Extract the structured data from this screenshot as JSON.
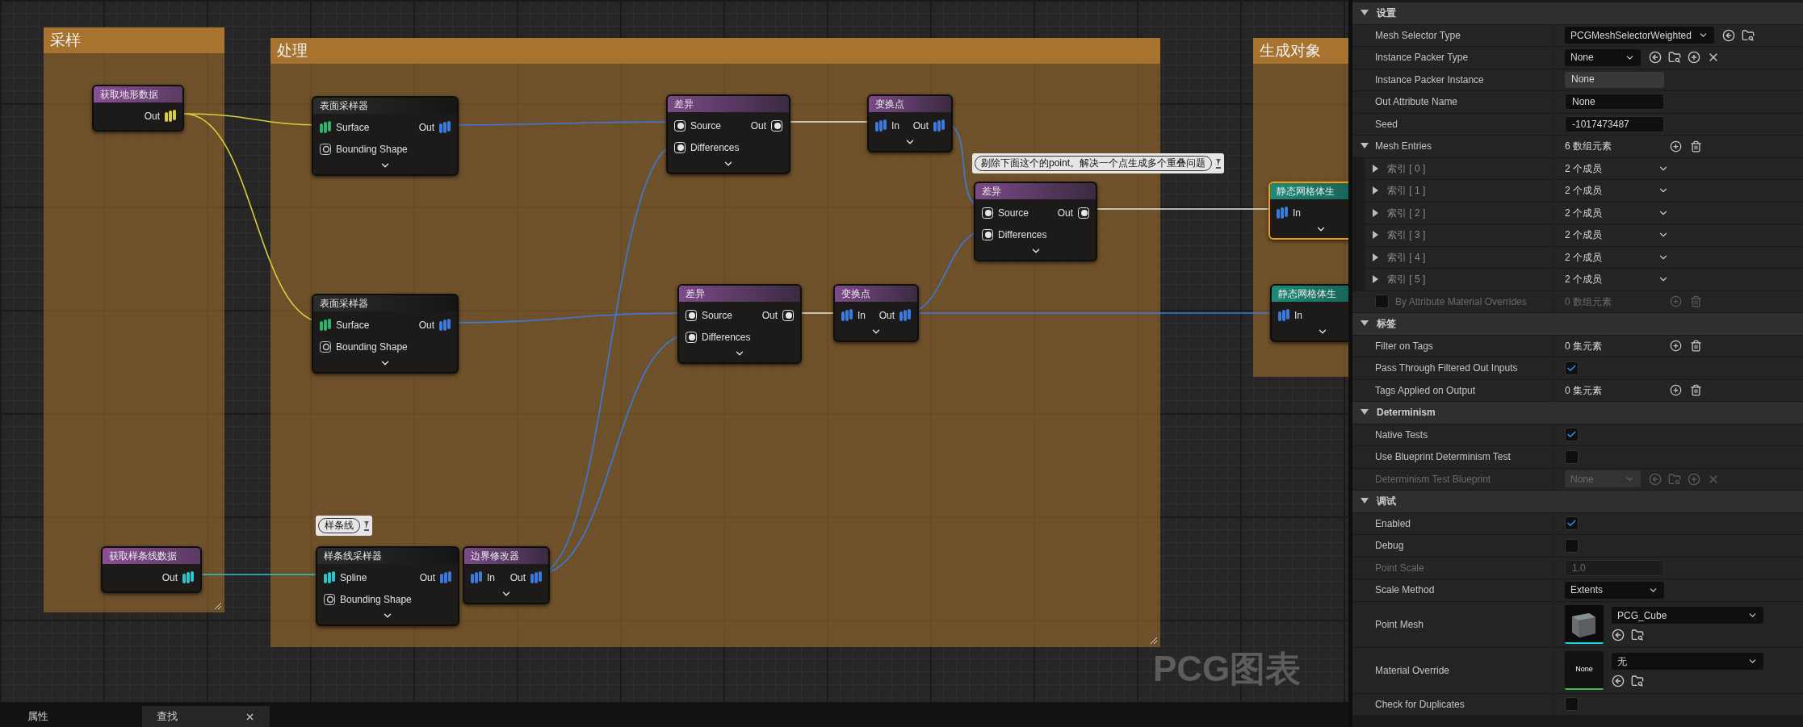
{
  "graph": {
    "comments": [
      {
        "title": "采样"
      },
      {
        "title": "处理"
      },
      {
        "title": "生成对象"
      }
    ],
    "nodes": [
      {
        "title": "获取地形数据",
        "kind": "input",
        "selected": false,
        "expandable": false,
        "outputs": [
          {
            "label": "Out",
            "kind": "bars",
            "color": "#d8cf3c"
          }
        ]
      },
      {
        "title": "表面采样器",
        "kind": "sampler",
        "selected": false,
        "expandable": true,
        "inputs": [
          {
            "label": "Surface",
            "kind": "bars",
            "color": "#35b06a"
          },
          {
            "label": "Bounding Shape",
            "kind": "ring",
            "color": "#c8c8c8"
          }
        ],
        "outputs": [
          {
            "label": "Out",
            "kind": "bars",
            "color": "#3a7be0"
          }
        ]
      },
      {
        "title": "差异",
        "kind": "filter",
        "selected": false,
        "expandable": true,
        "inputs": [
          {
            "label": "Source",
            "kind": "circle",
            "color": "#e6e6e6"
          },
          {
            "label": "Differences",
            "kind": "circle",
            "color": "#e6e6e6"
          }
        ],
        "outputs": [
          {
            "label": "Out",
            "kind": "circle",
            "color": "#e6e6e6"
          }
        ]
      },
      {
        "title": "变换点",
        "kind": "filter",
        "selected": false,
        "expandable": true,
        "inputs": [
          {
            "label": "In",
            "kind": "bars",
            "color": "#3a7be0"
          }
        ],
        "outputs": [
          {
            "label": "Out",
            "kind": "bars",
            "color": "#3a7be0"
          }
        ]
      },
      {
        "title": "差异",
        "kind": "filter",
        "selected": false,
        "expandable": true,
        "inputs": [
          {
            "label": "Source",
            "kind": "circle",
            "color": "#e6e6e6"
          },
          {
            "label": "Differences",
            "kind": "circle",
            "color": "#e6e6e6"
          }
        ],
        "outputs": [
          {
            "label": "Out",
            "kind": "circle",
            "color": "#e6e6e6"
          }
        ]
      },
      {
        "title": "静态网格体生",
        "kind": "spawner",
        "selected": true,
        "expandable": true,
        "inputs": [
          {
            "label": "In",
            "kind": "bars",
            "color": "#3a7be0"
          }
        ]
      },
      {
        "title": "表面采样器",
        "kind": "sampler",
        "selected": false,
        "expandable": true,
        "inputs": [
          {
            "label": "Surface",
            "kind": "bars",
            "color": "#35b06a"
          },
          {
            "label": "Bounding Shape",
            "kind": "ring",
            "color": "#c8c8c8"
          }
        ],
        "outputs": [
          {
            "label": "Out",
            "kind": "bars",
            "color": "#3a7be0"
          }
        ]
      },
      {
        "title": "差异",
        "kind": "filter",
        "selected": false,
        "expandable": true,
        "inputs": [
          {
            "label": "Source",
            "kind": "circle",
            "color": "#e6e6e6"
          },
          {
            "label": "Differences",
            "kind": "circle",
            "color": "#e6e6e6"
          }
        ],
        "outputs": [
          {
            "label": "Out",
            "kind": "circle",
            "color": "#e6e6e6"
          }
        ]
      },
      {
        "title": "变换点",
        "kind": "filter",
        "selected": false,
        "expandable": true,
        "inputs": [
          {
            "label": "In",
            "kind": "bars",
            "color": "#3a7be0"
          }
        ],
        "outputs": [
          {
            "label": "Out",
            "kind": "bars",
            "color": "#3a7be0"
          }
        ]
      },
      {
        "title": "静态网格体生",
        "kind": "spawner",
        "selected": false,
        "expandable": true,
        "inputs": [
          {
            "label": "In",
            "kind": "bars",
            "color": "#3a7be0"
          }
        ]
      },
      {
        "title": "获取样条线数据",
        "kind": "input",
        "selected": false,
        "expandable": false,
        "outputs": [
          {
            "label": "Out",
            "kind": "bars",
            "color": "#2ec4c9"
          }
        ]
      },
      {
        "title": "样条线采样器",
        "kind": "sampler",
        "selected": false,
        "expandable": true,
        "inputs": [
          {
            "label": "Spline",
            "kind": "bars",
            "color": "#2ec4c9"
          },
          {
            "label": "Bounding Shape",
            "kind": "ring",
            "color": "#c8c8c8"
          }
        ],
        "outputs": [
          {
            "label": "Out",
            "kind": "bars",
            "color": "#3a7be0"
          }
        ]
      },
      {
        "title": "边界修改器",
        "kind": "filter",
        "selected": false,
        "expandable": true,
        "inputs": [
          {
            "label": "In",
            "kind": "bars",
            "color": "#3a7be0"
          }
        ],
        "outputs": [
          {
            "label": "Out",
            "kind": "bars",
            "color": "#3a7be0"
          }
        ]
      }
    ],
    "bubbles": [
      {
        "text": "剔除下面这个的point。解决一个点生成多个重叠问题",
        "pinned": true
      },
      {
        "text": "样条线",
        "pinned": true
      }
    ],
    "watermark": "PCG图表"
  },
  "bottom_tabs": [
    {
      "label": "属性",
      "selected": false,
      "closable": false
    },
    {
      "label": "查找",
      "selected": true,
      "closable": true
    }
  ],
  "details": {
    "sections": [
      {
        "title": "设置",
        "expanded": true,
        "rows": [
          {
            "kind": "combo",
            "label": "Mesh Selector Type",
            "value": "PCGMeshSelectorWeighted",
            "clearable": false,
            "disabled": false
          },
          {
            "kind": "combo",
            "label": "Instance Packer Type",
            "value": "None",
            "clearable": true,
            "disabled": false
          },
          {
            "kind": "readonly",
            "label": "Instance Packer Instance",
            "value": "None",
            "disabled": false
          },
          {
            "kind": "text",
            "label": "Out Attribute Name",
            "value": "None",
            "disabled": false
          },
          {
            "kind": "text",
            "label": "Seed",
            "value": "-1017473487",
            "disabled": false
          },
          {
            "kind": "array",
            "label": "Mesh Entries",
            "value": "6 数组元素",
            "expanded": true,
            "disabled": false,
            "children": [
              {
                "label": "索引 [ 0 ]",
                "value": "2 个成员",
                "expanded": false
              },
              {
                "label": "索引 [ 1 ]",
                "value": "2 个成员",
                "expanded": false
              },
              {
                "label": "索引 [ 2 ]",
                "value": "2 个成员",
                "expanded": false
              },
              {
                "label": "索引 [ 3 ]",
                "value": "2 个成员",
                "expanded": false
              },
              {
                "label": "索引 [ 4 ]",
                "value": "2 个成员",
                "expanded": false
              },
              {
                "label": "索引 [ 5 ]",
                "value": "2 个成员",
                "expanded": false
              }
            ]
          },
          {
            "kind": "array",
            "label": "By Attribute Material Overrides",
            "value": "0 数组元素",
            "checked": false,
            "disabled": true
          }
        ]
      },
      {
        "title": "标签",
        "expanded": true,
        "rows": [
          {
            "kind": "array",
            "label": "Filter on Tags",
            "value": "0 集元素",
            "disabled": false
          },
          {
            "kind": "checkbox",
            "label": "Pass Through Filtered Out Inputs",
            "checked": true,
            "disabled": false
          },
          {
            "kind": "array",
            "label": "Tags Applied on Output",
            "value": "0 集元素",
            "disabled": false
          }
        ]
      },
      {
        "title": "Determinism",
        "expanded": true,
        "rows": [
          {
            "kind": "checkbox",
            "label": "Native Tests",
            "checked": true,
            "disabled": false
          },
          {
            "kind": "checkbox",
            "label": "Use Blueprint Determinism Test",
            "checked": false,
            "disabled": false
          },
          {
            "kind": "combo",
            "label": "Determinism Test Blueprint",
            "value": "None",
            "clearable": true,
            "disabled": true
          }
        ]
      },
      {
        "title": "调试",
        "expanded": true,
        "rows": [
          {
            "kind": "checkbox",
            "label": "Enabled",
            "checked": true,
            "disabled": false
          },
          {
            "kind": "checkbox",
            "label": "Debug",
            "checked": false,
            "disabled": false
          },
          {
            "kind": "text",
            "label": "Point Scale",
            "value": "1.0",
            "disabled": true
          },
          {
            "kind": "enum",
            "label": "Scale Method",
            "value": "Extents",
            "disabled": false
          },
          {
            "kind": "asset",
            "label": "Point Mesh",
            "value": "PCG_Cube",
            "color": "#19d3e6",
            "disabled": false
          },
          {
            "kind": "asset",
            "label": "Material Override",
            "value": "无",
            "color": "#37c24a",
            "thumbnail": {
              "text": "None"
            },
            "disabled": false
          },
          {
            "kind": "checkbox",
            "label": "Check for Duplicates",
            "checked": false,
            "disabled": false
          }
        ]
      }
    ]
  }
}
